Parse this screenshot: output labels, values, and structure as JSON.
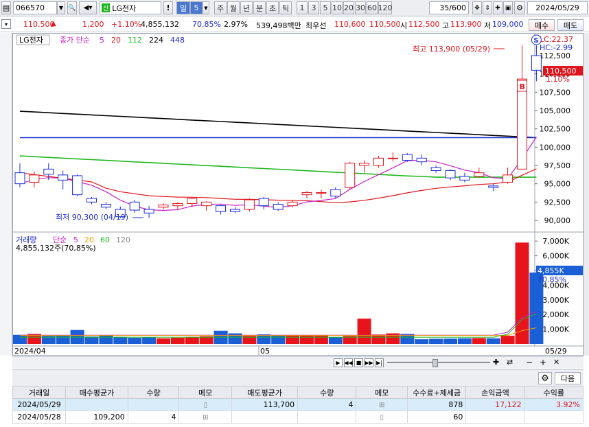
{
  "toolbar": {
    "stock_code": "066570",
    "stock_name": "LG전자",
    "period_label": "일",
    "period_value": "5",
    "period_buttons": [
      "주",
      "월",
      "년",
      "분",
      "초",
      "틱"
    ],
    "number_buttons": [
      "1",
      "3",
      "5",
      "10",
      "20",
      "30",
      "60",
      "120"
    ],
    "page_counter": "35/600",
    "date": "2024/05/29",
    "buy_label": "매수",
    "sell_label": "매도"
  },
  "quote": {
    "price": "110,500",
    "change": "1,200",
    "change_pct": "+1.10%",
    "volume": "4,855,132",
    "vol_ratio": "70.85%",
    "turnover_pct": "2.97%",
    "trade_value": "539,498백만",
    "best_label": "최우선",
    "bid": "110,600",
    "ask": "110,500",
    "open_label": "시",
    "open": "112,500",
    "high_label": "고",
    "high": "113,900",
    "low_label": "저",
    "low": "109,000"
  },
  "price_panel": {
    "name": "LG전자",
    "legend_title": "종가 단순",
    "legend_periods": [
      "5",
      "20",
      "112",
      "224",
      "448"
    ],
    "legend_colors": [
      "#c71fc7",
      "#e0141c",
      "#1fb81f",
      "#000000",
      "#1a2bd6"
    ],
    "lc": "LC:22.37",
    "hc": "HC:-2.99",
    "high_annotation": "최고 113,900 (05/29)",
    "low_annotation": "최저 90,300 (04/19)",
    "current_price_tag": "110,500",
    "current_pct_tag": "1.10%",
    "y_ticks": [
      "112,500",
      "110,000",
      "107,500",
      "105,000",
      "102,500",
      "100,000",
      "97,500",
      "95,000",
      "92,500",
      "90,000"
    ],
    "buy_marker": "B",
    "sell_marker": "S"
  },
  "volume_panel": {
    "legend_title": "거래량",
    "legend_ma": "단순",
    "legend_periods": [
      "5",
      "20",
      "60",
      "120"
    ],
    "legend_colors": [
      "#c71fc7",
      "#e8a000",
      "#1fb81f",
      "#888888"
    ],
    "current": "4,855,132주(70,85%)",
    "tag_value": "4,855K",
    "tag_pct": "70.85%",
    "y_ticks": [
      "7,000K",
      "6,000K",
      "5,000K",
      "4,000K",
      "3,000K",
      "2,000K",
      "1,000K"
    ]
  },
  "x_axis": [
    "2024/04",
    "05",
    "05/29"
  ],
  "chart_data": {
    "type": "candlestick",
    "series": [
      {
        "name": "candles",
        "values": [
          [
            96.5,
            97.8,
            94.5,
            95.0
          ],
          [
            95.2,
            96.7,
            94.5,
            96.2
          ],
          [
            97.0,
            97.8,
            95.5,
            96.3
          ],
          [
            96.2,
            96.8,
            94.2,
            95.5
          ],
          [
            96.1,
            96.3,
            93.3,
            93.5
          ],
          [
            93.0,
            93.2,
            92.2,
            92.5
          ],
          [
            92.2,
            92.5,
            91.5,
            91.8
          ],
          [
            91.5,
            91.9,
            90.3,
            90.5
          ],
          [
            92.5,
            92.8,
            91.0,
            91.4
          ],
          [
            91.5,
            92.0,
            90.3,
            91.0
          ],
          [
            91.8,
            92.3,
            91.5,
            92.1
          ],
          [
            92.0,
            92.5,
            91.5,
            92.3
          ],
          [
            92.3,
            93.2,
            91.8,
            93.0
          ],
          [
            92.0,
            92.6,
            91.3,
            92.5
          ],
          [
            92.0,
            92.1,
            90.8,
            91.2
          ],
          [
            91.5,
            91.8,
            91.0,
            91.2
          ],
          [
            91.5,
            93.0,
            91.2,
            92.8
          ],
          [
            93.0,
            93.2,
            91.5,
            92.0
          ],
          [
            92.2,
            92.5,
            91.3,
            91.5
          ],
          [
            92.0,
            92.8,
            91.8,
            92.5
          ],
          [
            93.5,
            94.0,
            93.0,
            93.8
          ],
          [
            93.7,
            94.2,
            93.0,
            93.8
          ],
          [
            94.2,
            94.5,
            93.0,
            93.3
          ],
          [
            94.5,
            98.0,
            94.2,
            97.8
          ],
          [
            97.5,
            98.2,
            96.5,
            97.8
          ],
          [
            97.5,
            98.8,
            97.2,
            98.5
          ],
          [
            98.5,
            99.3,
            98.0,
            98.5
          ],
          [
            99.0,
            99.2,
            98.0,
            98.2
          ],
          [
            98.5,
            99.0,
            97.5,
            98.0
          ],
          [
            97.2,
            97.5,
            96.5,
            96.8
          ],
          [
            96.8,
            97.0,
            95.5,
            95.8
          ],
          [
            96.0,
            96.5,
            95.2,
            95.5
          ],
          [
            96.0,
            97.2,
            95.8,
            96.5
          ],
          [
            94.7,
            95.0,
            94.0,
            94.5
          ],
          [
            95.2,
            97.2,
            95.0,
            96.2
          ],
          [
            97.0,
            113.9,
            97.0,
            109.3
          ],
          [
            112.5,
            113.9,
            109.0,
            110.5
          ]
        ]
      },
      {
        "name": "volume_K",
        "values": [
          620,
          680,
          550,
          560,
          950,
          500,
          600,
          480,
          420,
          460,
          380,
          420,
          480,
          520,
          900,
          720,
          550,
          650,
          560,
          600,
          580,
          560,
          470,
          540,
          1720,
          640,
          720,
          680,
          320,
          350,
          360,
          380,
          400,
          380,
          560,
          6900,
          4860
        ]
      }
    ],
    "ylim_price": [
      89000,
      115000
    ],
    "ylim_volume": [
      0,
      7300
    ]
  },
  "table": {
    "settings_icon": "gear-icon",
    "next_label": "다음",
    "headers": [
      "거래일",
      "매수평균가",
      "수량",
      "메모",
      "매도평균가",
      "수량",
      "메모",
      "수수료+제세금",
      "손익금액",
      "수익률"
    ],
    "rows": [
      {
        "date": "2024/05/29",
        "buy_avg": "",
        "buy_qty": "",
        "memo1": "",
        "sell_avg": "113,700",
        "sell_qty": "4",
        "memo2": "",
        "fee": "878",
        "pnl": "17,122",
        "ret": "3.92%"
      },
      {
        "date": "2024/05/28",
        "buy_avg": "109,200",
        "buy_qty": "4",
        "memo1": "",
        "sell_avg": "",
        "sell_qty": "",
        "memo2": "",
        "fee": "60",
        "pnl": "",
        "ret": ""
      }
    ]
  }
}
